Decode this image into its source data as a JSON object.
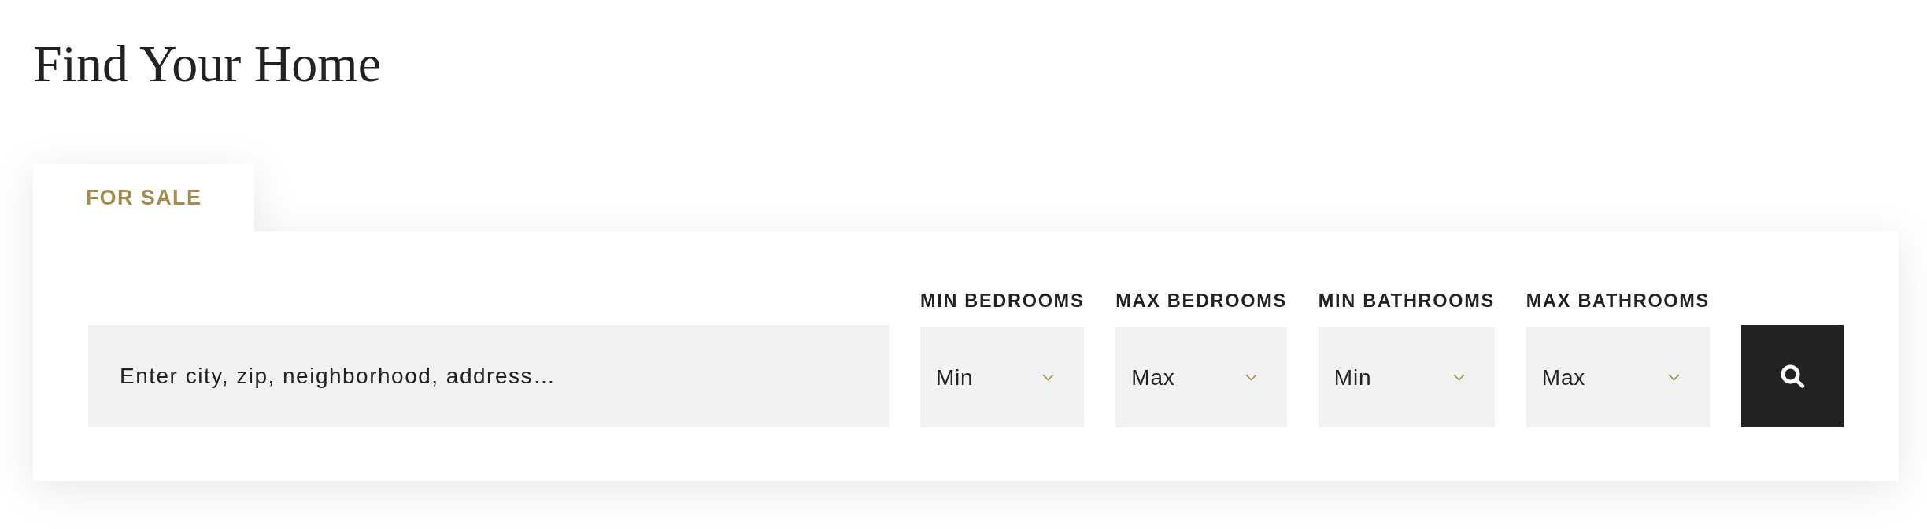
{
  "title": "Find Your Home",
  "tabs": [
    {
      "label": "FOR SALE",
      "selected": true
    }
  ],
  "search": {
    "placeholder": "Enter city, zip, neighborhood, address…"
  },
  "filters": [
    {
      "label": "MIN BEDROOMS",
      "value": "Min"
    },
    {
      "label": "MAX BEDROOMS",
      "value": "Max"
    },
    {
      "label": "MIN BATHROOMS",
      "value": "Min"
    },
    {
      "label": "MAX BATHROOMS",
      "value": "Max"
    }
  ]
}
